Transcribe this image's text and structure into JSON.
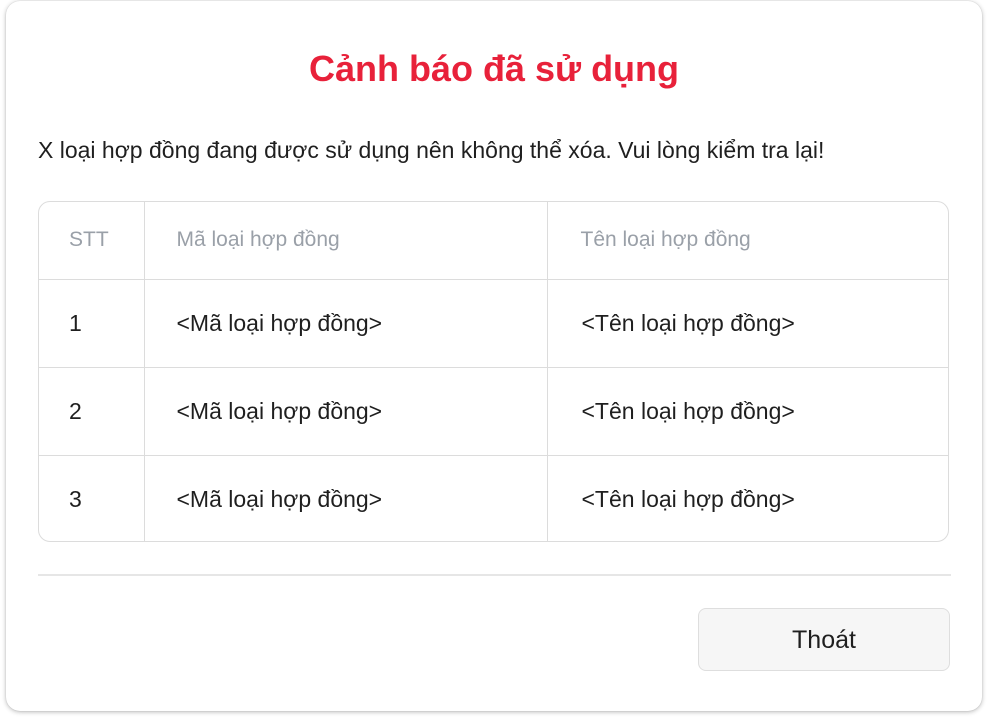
{
  "dialog": {
    "title": "Cảnh báo đã sử dụng",
    "message": "X loại hợp đồng đang được sử dụng nên không thể xóa. Vui lòng kiểm tra lại!",
    "title_color": "#e8213a"
  },
  "table": {
    "headers": [
      "STT",
      "Mã loại hợp đồng",
      "Tên loại hợp đồng"
    ],
    "rows": [
      {
        "stt": "1",
        "ma": "<Mã loại hợp đồng>",
        "ten": "<Tên loại hợp đồng>"
      },
      {
        "stt": "2",
        "ma": "<Mã loại hợp đồng>",
        "ten": "<Tên loại hợp đồng>"
      },
      {
        "stt": "3",
        "ma": "<Mã loại hợp đồng>",
        "ten": "<Tên loại hợp đồng>"
      }
    ]
  },
  "footer": {
    "exit_label": "Thoát"
  }
}
